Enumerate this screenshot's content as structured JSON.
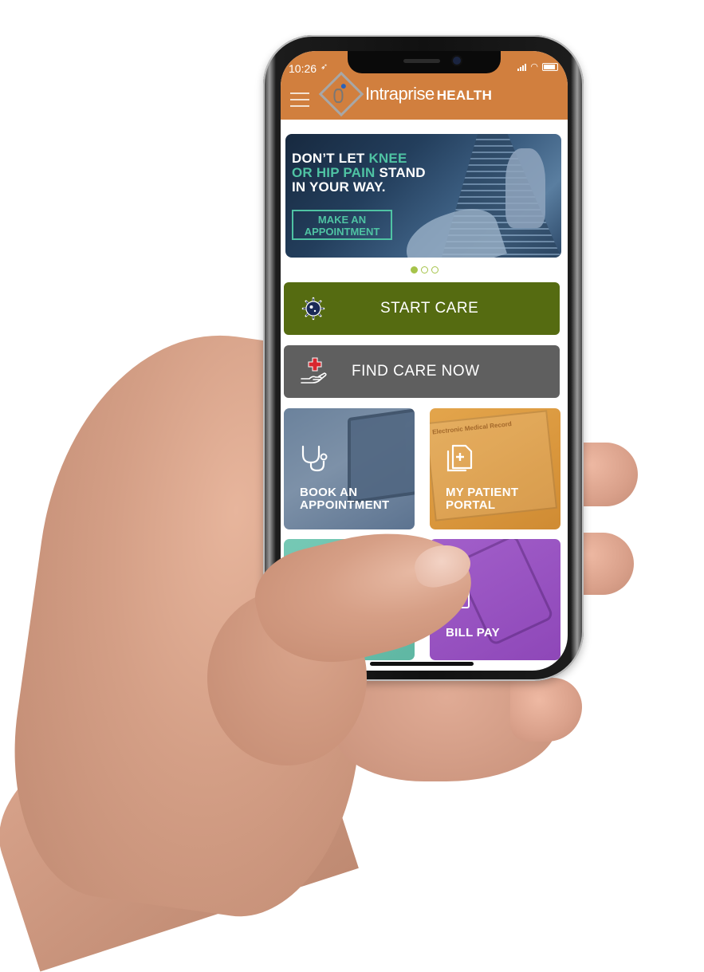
{
  "status_bar": {
    "time": "10:26",
    "location_icon": "location-arrow-icon",
    "signal_icon": "cellular-signal-icon",
    "wifi_icon": "wifi-icon",
    "battery_icon": "battery-icon"
  },
  "header": {
    "menu_icon": "hamburger-menu-icon",
    "brand_name": "Intraprise",
    "brand_suffix": "HEALTH",
    "background_color": "#d17f3e"
  },
  "banner": {
    "headline_parts": [
      {
        "text": "DON’T LET ",
        "highlight": false
      },
      {
        "text": "KNEE",
        "highlight": true
      },
      {
        "text": "OR HIP PAIN",
        "highlight": true
      },
      {
        "text": " STAND",
        "highlight": false
      },
      {
        "text": "IN YOUR WAY.",
        "highlight": false
      }
    ],
    "cta_line1": "MAKE AN",
    "cta_line2": "APPOINTMENT",
    "highlight_color": "#4fc3a3"
  },
  "carousel": {
    "total": 3,
    "active_index": 0
  },
  "actions": [
    {
      "label": "START  CARE",
      "icon": "virus-icon",
      "color": "#556b11"
    },
    {
      "label": "FIND CARE NOW",
      "icon": "hand-medical-cross-icon",
      "color": "#5f5f5f"
    }
  ],
  "tiles": [
    {
      "line1": "BOOK AN",
      "line2": "APPOINTMENT",
      "icon": "stethoscope-icon",
      "color": "#6b829c"
    },
    {
      "line1": "MY PATIENT",
      "line2": "PORTAL",
      "icon": "medical-document-icon",
      "color": "#e3a54c",
      "image_caption": "Electronic Medical Record"
    },
    {
      "line1": "",
      "line2": "",
      "icon": "obscured-icon",
      "color": "#76c9b5"
    },
    {
      "line1": "BILL PAY",
      "line2": "",
      "icon": "bill-icon",
      "color": "#a25fca"
    }
  ]
}
